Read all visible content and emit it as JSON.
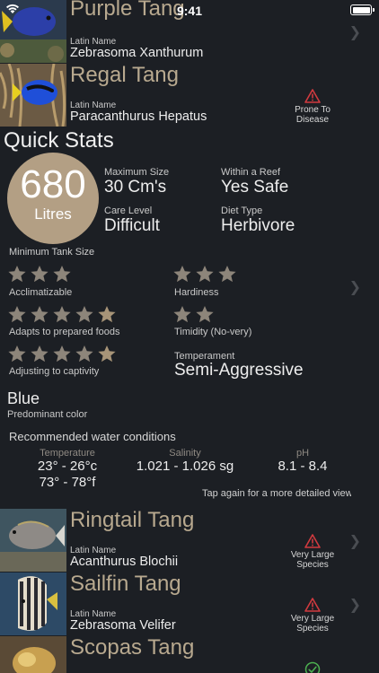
{
  "status_bar": {
    "time": "9:41"
  },
  "fish_top": [
    {
      "name": "Purple Tang",
      "latin_label": "Latin Name",
      "latin": "Zebrasoma Xanthurum"
    },
    {
      "name": "Regal Tang",
      "latin_label": "Latin Name",
      "latin": "Paracanthurus Hepatus",
      "warning": "Prone To Disease"
    }
  ],
  "quick_stats": {
    "title": "Quick Stats",
    "tank_size": {
      "value": "680",
      "unit": "Litres",
      "label": "Minimum Tank Size"
    },
    "max_size": {
      "label": "Maximum Size",
      "value": "30 Cm's"
    },
    "reef": {
      "label": "Within a Reef",
      "value": "Yes Safe"
    },
    "care": {
      "label": "Care Level",
      "value": "Difficult"
    },
    "diet": {
      "label": "Diet Type",
      "value": "Herbivore"
    },
    "ratings": [
      {
        "label": "Acclimatizable",
        "stars": 3
      },
      {
        "label": "Hardiness",
        "stars": 3
      },
      {
        "label": "Adapts to prepared foods",
        "stars": 5
      },
      {
        "label": "Timidity (No-very)",
        "stars": 2
      },
      {
        "label": "Adjusting to captivity",
        "stars": 5
      }
    ],
    "temperament": {
      "label": "Temperament",
      "value": "Semi-Aggressive"
    },
    "color": {
      "value": "Blue",
      "label": "Predominant color"
    },
    "water": {
      "title": "Recommended water conditions",
      "temperature": {
        "label": "Temperature",
        "celsius": "23° - 26°c",
        "fahrenheit": "73° - 78°f"
      },
      "salinity": {
        "label": "Salinity",
        "value": "1.021 - 1.026 sg"
      },
      "ph": {
        "label": "pH",
        "value": "8.1 - 8.4"
      }
    },
    "hint": "Tap again for a more detailed view"
  },
  "fish_bottom": [
    {
      "name": "Ringtail Tang",
      "latin_label": "Latin Name",
      "latin": "Acanthurus Blochii",
      "warning": "Very Large Species"
    },
    {
      "name": "Sailfin Tang",
      "latin_label": "Latin Name",
      "latin": "Zebrasoma Velifer",
      "warning": "Very Large Species"
    },
    {
      "name": "Scopas Tang"
    }
  ],
  "colors": {
    "accent": "#b39f84",
    "star_filled": "#8d857a",
    "star_last": "#a79478",
    "warning": "#d13a3f",
    "check": "#4caf50",
    "background": "#1c1f24"
  }
}
